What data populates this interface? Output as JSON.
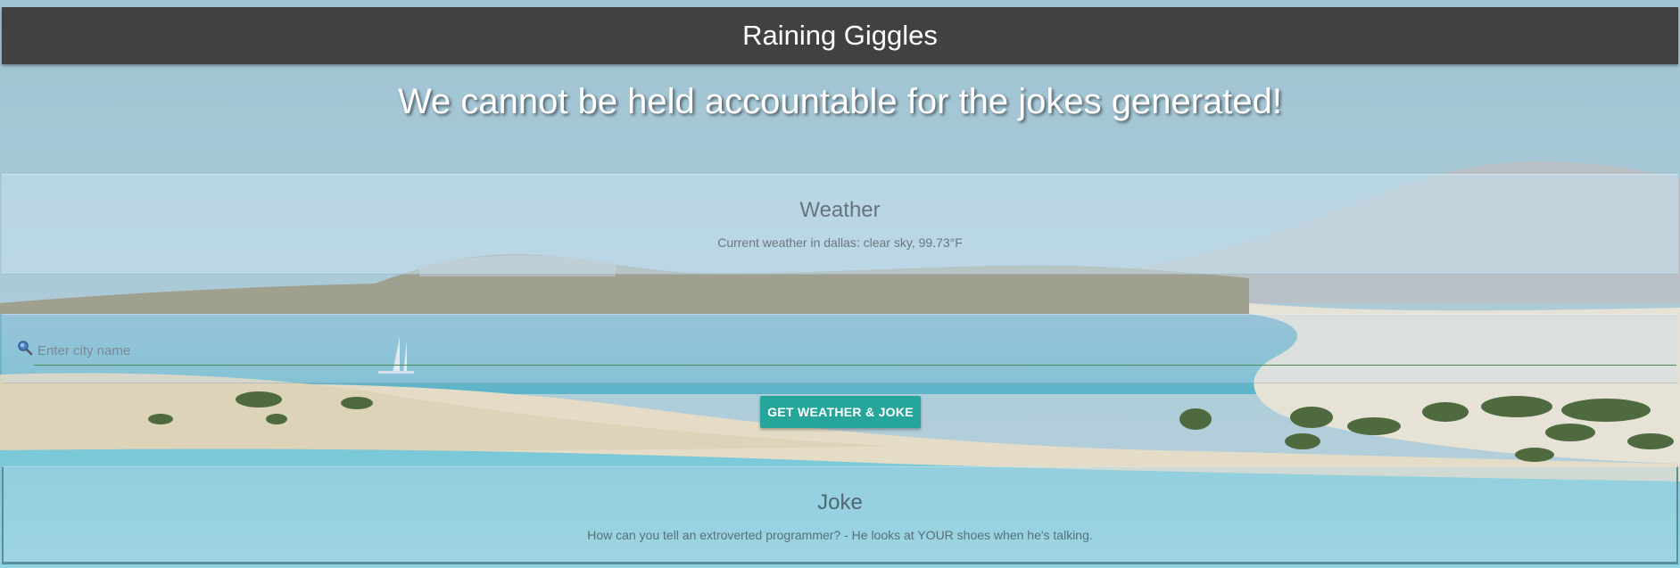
{
  "header": {
    "title": "Raining Giggles"
  },
  "tagline": "We cannot be held accountable for the jokes generated!",
  "weather": {
    "heading": "Weather",
    "text": "Current weather in dallas: clear sky, 99.73°F"
  },
  "search": {
    "placeholder": "Enter city name",
    "value": "",
    "icon": "search-icon"
  },
  "button": {
    "label": "GET WEATHER & JOKE"
  },
  "joke": {
    "heading": "Joke",
    "text": "How can you tell an extroverted programmer? - He looks at YOUR shoes when he's talking."
  },
  "colors": {
    "header_bg": "#414141",
    "button_bg": "#26a69a",
    "input_underline": "#4f8a4f"
  }
}
